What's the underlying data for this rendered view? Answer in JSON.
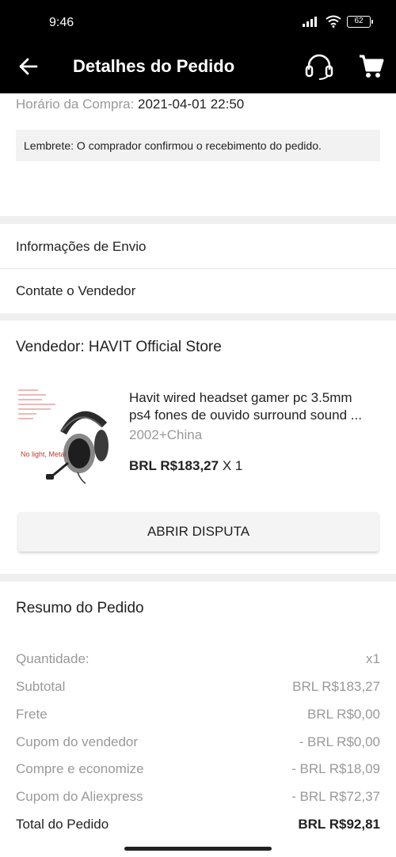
{
  "status_bar": {
    "time": "9:46",
    "battery": "62"
  },
  "header": {
    "title": "Detalhes do Pedido",
    "back_icon": "arrow-left-icon",
    "support_icon": "headset-icon",
    "cart_icon": "cart-icon"
  },
  "order": {
    "purchase_time_label": "Horário da Compra:",
    "purchase_time_value": "2021-04-01 22:50",
    "reminder": "Lembrete: O comprador confirmou o recebimento do pedido."
  },
  "menu": {
    "shipping_info": "Informações de Envio",
    "contact_seller": "Contate o Vendedor"
  },
  "seller": {
    "label": "Vendedor: HAVIT Official Store",
    "product": {
      "title_line1": "Havit wired headset gamer pc 3.5mm",
      "title_line2": "ps4 fones de ouvido surround sound ...",
      "variant": "2002+China",
      "price": "BRL R$183,27",
      "quantity": "X 1",
      "image_caption": "No light, Metal"
    },
    "dispute_button": "ABRIR DISPUTA"
  },
  "summary": {
    "title": "Resumo do Pedido",
    "rows": [
      {
        "label": "Quantidade:",
        "value": "x1"
      },
      {
        "label": "Subtotal",
        "value": "BRL R$183,27"
      },
      {
        "label": "Frete",
        "value": "BRL R$0,00"
      },
      {
        "label": "Cupom do vendedor",
        "value": "- BRL R$0,00"
      },
      {
        "label": "Compre e economize",
        "value": "- BRL R$18,09"
      },
      {
        "label": "Cupom do Aliexpress",
        "value": "- BRL R$72,37"
      }
    ],
    "total_label": "Total do Pedido",
    "total_value": "BRL R$92,81"
  }
}
